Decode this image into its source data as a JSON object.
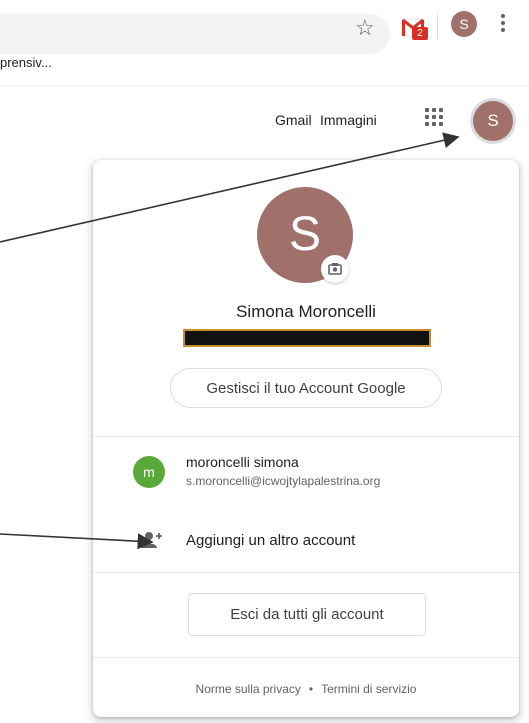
{
  "browser": {
    "bookmark_text": "prensiv...",
    "gmail_badge": "2",
    "profile_initial": "S",
    "icons": [
      "star-icon",
      "gmail-icon",
      "kebab-menu-icon"
    ]
  },
  "header": {
    "gmail_link": "Gmail",
    "images_link": "Immagini",
    "avatar_initial": "S",
    "icons": [
      "apps-grid-icon"
    ]
  },
  "panel": {
    "avatar_initial": "S",
    "user_name": "Simona Moroncelli",
    "manage_button": "Gestisci il tuo Account Google",
    "other_account": {
      "initial": "m",
      "name": "moroncelli simona",
      "email": "s.moroncelli@icwojtylapalestrina.org"
    },
    "add_account": "Aggiungi un altro account",
    "signout_button": "Esci da tutti gli account",
    "footer": {
      "privacy": "Norme sulla privacy",
      "separator": "•",
      "terms": "Termini di servizio"
    }
  },
  "colors": {
    "avatar": "#a0716a",
    "secondary_avatar": "#5aa83a",
    "redaction": "#111111",
    "redaction_border": "#c58d2f"
  }
}
